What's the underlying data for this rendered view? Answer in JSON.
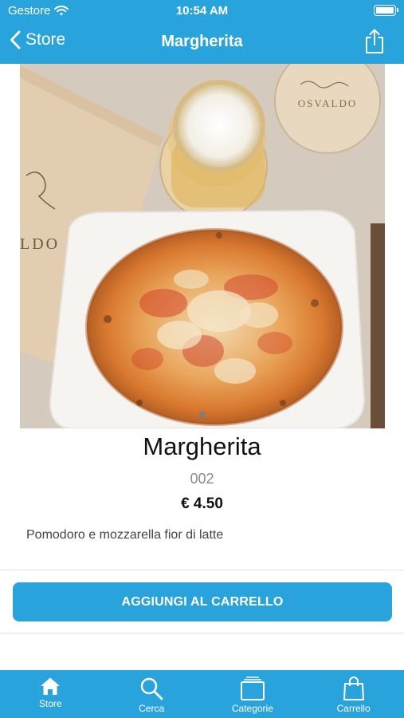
{
  "status_bar": {
    "carrier": "Gestore",
    "time": "10:54 AM"
  },
  "nav": {
    "back_label": "Store",
    "title": "Margherita"
  },
  "product": {
    "name": "Margherita",
    "code": "002",
    "price": "€ 4.50",
    "description": "Pomodoro e mozzarella fior di latte",
    "image_count": 1,
    "image_index": 1
  },
  "image_text": {
    "coaster_brand": "OSVALDO",
    "menu_brand": "LDO"
  },
  "actions": {
    "add_to_cart": "AGGIUNGI AL CARRELLO"
  },
  "tabbar": {
    "items": [
      {
        "label": "Store",
        "icon": "home-icon"
      },
      {
        "label": "Cerca",
        "icon": "search-icon"
      },
      {
        "label": "Categorie",
        "icon": "categories-icon"
      },
      {
        "label": "Carrello",
        "icon": "shopping-bag-icon"
      }
    ]
  },
  "colors": {
    "accent": "#29a3db",
    "background": "#ffffff"
  }
}
